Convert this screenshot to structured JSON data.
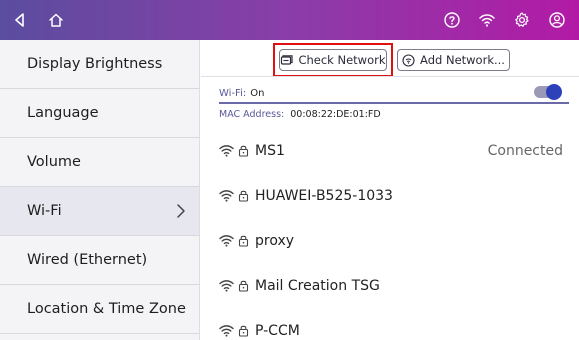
{
  "topbar": {
    "icons": [
      "back-arrow-icon",
      "home-icon",
      "help-icon",
      "wifi-icon",
      "settings-icon",
      "account-icon"
    ]
  },
  "sidebar": {
    "items": [
      {
        "label": "Display Brightness"
      },
      {
        "label": "Language"
      },
      {
        "label": "Volume"
      },
      {
        "label": "Wi-Fi",
        "selected": true
      },
      {
        "label": "Wired (Ethernet)"
      },
      {
        "label": "Location & Time Zone"
      }
    ]
  },
  "toolbar": {
    "check_network_label": "Check Network",
    "add_network_label": "Add Network..."
  },
  "wifi": {
    "label": "Wi-Fi:",
    "value": "On",
    "enabled": true
  },
  "mac": {
    "label": "MAC Address:",
    "value": "00:08:22:DE:01:FD"
  },
  "networks": [
    {
      "name": "MS1",
      "status": "Connected"
    },
    {
      "name": "HUAWEI-B525-1033",
      "status": ""
    },
    {
      "name": "proxy",
      "status": ""
    },
    {
      "name": "Mail Creation TSG",
      "status": ""
    },
    {
      "name": "P-CCM",
      "status": ""
    }
  ],
  "colors": {
    "highlight": "#e01010",
    "toggle_on": "#2d42b8",
    "label_accent": "#5a5a9a"
  }
}
